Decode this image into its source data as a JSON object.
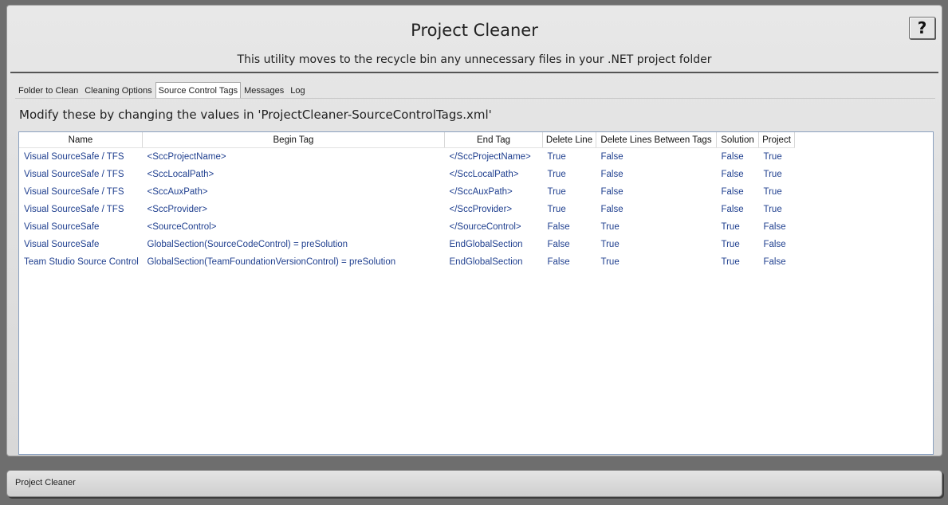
{
  "header": {
    "title": "Project Cleaner",
    "subtitle": "This utility moves to the recycle bin any unnecessary files in your .NET project folder",
    "help_label": "?"
  },
  "tabs": [
    {
      "label": "Folder to Clean",
      "active": false
    },
    {
      "label": "Cleaning Options",
      "active": false
    },
    {
      "label": "Source Control Tags",
      "active": true
    },
    {
      "label": "Messages",
      "active": false
    },
    {
      "label": "Log",
      "active": false
    }
  ],
  "note": "Modify these by changing the values in 'ProjectCleaner-SourceControlTags.xml'",
  "grid": {
    "columns": [
      "Name",
      "Begin Tag",
      "End Tag",
      "Delete Line",
      "Delete Lines Between Tags",
      "Solution",
      "Project"
    ],
    "rows": [
      [
        "Visual SourceSafe / TFS",
        "<SccProjectName>",
        "</SccProjectName>",
        "True",
        "False",
        "False",
        "True"
      ],
      [
        "Visual SourceSafe / TFS",
        "<SccLocalPath>",
        "</SccLocalPath>",
        "True",
        "False",
        "False",
        "True"
      ],
      [
        "Visual SourceSafe / TFS",
        "<SccAuxPath>",
        "</SccAuxPath>",
        "True",
        "False",
        "False",
        "True"
      ],
      [
        "Visual SourceSafe / TFS",
        "<SccProvider>",
        "</SccProvider>",
        "True",
        "False",
        "False",
        "True"
      ],
      [
        "Visual SourceSafe",
        "<SourceControl>",
        "</SourceControl>",
        "False",
        "True",
        "True",
        "False"
      ],
      [
        "Visual SourceSafe",
        "GlobalSection(SourceCodeControl) = preSolution",
        "EndGlobalSection",
        "False",
        "True",
        "True",
        "False"
      ],
      [
        "Team Studio Source Control",
        "GlobalSection(TeamFoundationVersionControl) = preSolution",
        "EndGlobalSection",
        "False",
        "True",
        "True",
        "False"
      ]
    ]
  },
  "status": {
    "text": "Project Cleaner"
  }
}
